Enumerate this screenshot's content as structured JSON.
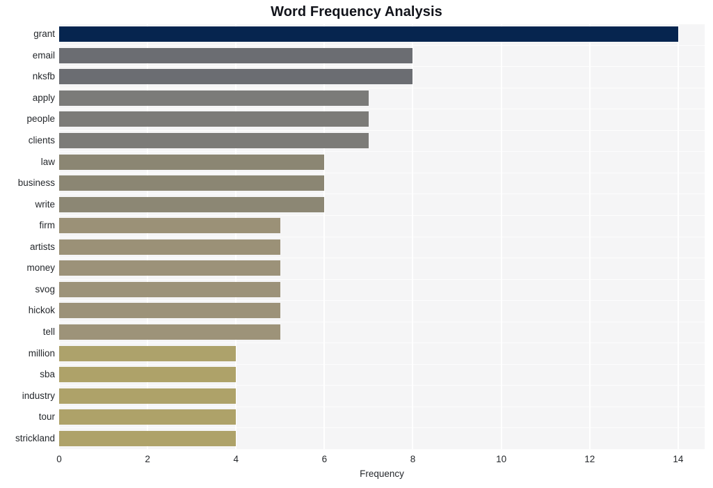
{
  "chart_data": {
    "type": "bar",
    "orientation": "horizontal",
    "title": "Word Frequency Analysis",
    "xlabel": "Frequency",
    "ylabel": "",
    "xlim": [
      0,
      14.6
    ],
    "ylim": [
      0,
      20
    ],
    "grid": true,
    "legend": null,
    "xticks": [
      0,
      2,
      4,
      6,
      8,
      10,
      12,
      14
    ],
    "xtick_labels": [
      "0",
      "2",
      "4",
      "6",
      "8",
      "10",
      "12",
      "14"
    ],
    "categories": [
      "grant",
      "email",
      "nksfb",
      "apply",
      "people",
      "clients",
      "law",
      "business",
      "write",
      "firm",
      "artists",
      "money",
      "svog",
      "hickok",
      "tell",
      "million",
      "sba",
      "industry",
      "tour",
      "strickland"
    ],
    "values": [
      14,
      8,
      8,
      7,
      7,
      7,
      6,
      6,
      6,
      5,
      5,
      5,
      5,
      5,
      5,
      4,
      4,
      4,
      4,
      4
    ],
    "bar_colors": [
      "#06254f",
      "#6b6d72",
      "#6b6d72",
      "#7b7b79",
      "#7c7b78",
      "#7c7b78",
      "#8b8673",
      "#8b8673",
      "#8c8774",
      "#9b9177",
      "#9b9177",
      "#9c9279",
      "#9c9279",
      "#9c9279",
      "#9d9379",
      "#ada26b",
      "#aea269",
      "#aea269",
      "#aea269",
      "#aea269"
    ],
    "plot_background": "#f5f5f6",
    "gridline_color": "#ffffff",
    "figure_background": "#ffffff",
    "text_color": "#25282c",
    "title_color": "#11131a"
  }
}
